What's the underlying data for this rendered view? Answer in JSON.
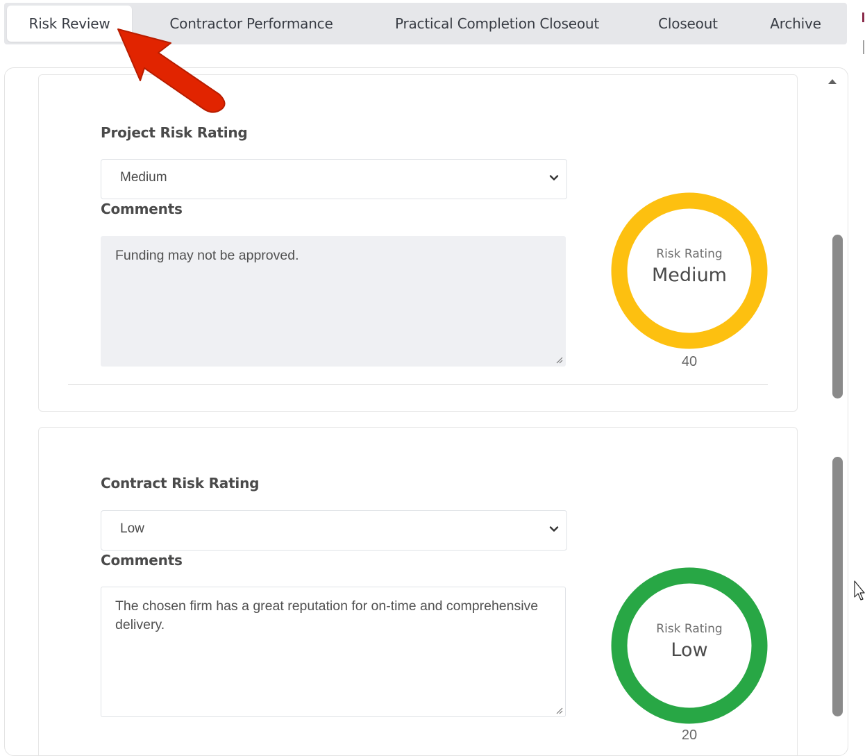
{
  "tabs": [
    {
      "label": "Risk Review",
      "active": true
    },
    {
      "label": "Contractor Performance",
      "active": false
    },
    {
      "label": "Practical Completion Closeout",
      "active": false
    },
    {
      "label": "Closeout",
      "active": false
    },
    {
      "label": "Archive",
      "active": false
    }
  ],
  "sections": [
    {
      "label": "Project Risk Rating",
      "selected": "Medium",
      "comments_label": "Comments",
      "comments_text": "Funding may not be approved.",
      "gauge": {
        "caption": "Risk Rating",
        "rating": "Medium",
        "score": "40",
        "color": "#fdc010"
      }
    },
    {
      "label": "Contract Risk Rating",
      "selected": "Low",
      "comments_label": "Comments",
      "comments_text": "The chosen firm has a great reputation for on-time and comprehensive delivery.",
      "gauge": {
        "caption": "Risk Rating",
        "rating": "Low",
        "score": "20",
        "color": "#28a745"
      }
    }
  ],
  "annotation": {
    "arrow_color": "#e12400",
    "points_to": "tab-risk-review"
  },
  "icons": [
    "chevron-down-icon",
    "resize-handle-icon",
    "scroll-up-icon",
    "mouse-cursor-icon"
  ]
}
